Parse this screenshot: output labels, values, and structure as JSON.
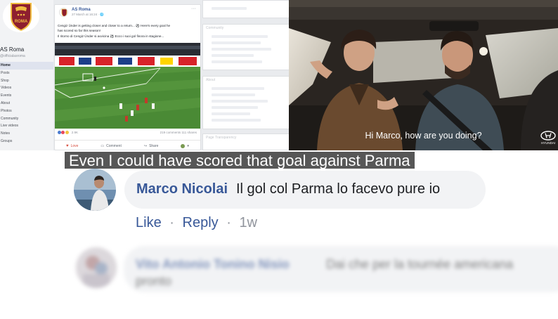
{
  "facebook_page": {
    "page_name": "AS Roma",
    "handle": "@officialasroma",
    "logo_text": "ROMA",
    "nav": [
      {
        "label": "Home",
        "active": true
      },
      {
        "label": "Posts",
        "active": false
      },
      {
        "label": "Shop",
        "active": false
      },
      {
        "label": "Videos",
        "active": false
      },
      {
        "label": "Events",
        "active": false
      },
      {
        "label": "About",
        "active": false
      },
      {
        "label": "Photos",
        "active": false
      },
      {
        "label": "Community",
        "active": false
      },
      {
        "label": "Live videos",
        "active": false
      },
      {
        "label": "Notes",
        "active": false
      },
      {
        "label": "Groups",
        "active": false
      }
    ],
    "post": {
      "author": "AS Roma",
      "date": "27 March at 16:24 · 🌐",
      "text_line1": "Cengiz Ünder is getting closer and closer to a return... ⚽ Here's every goal he",
      "text_line2": "has scored so far this season!",
      "text_line3": "Il ritorno di Cengiz Ünder si avvicina ⚽ Ecco i suoi gol finora in stagione...",
      "reaction_count": "2.9K",
      "comments_shares": "219 comments 111 shares",
      "actions": {
        "like": "Love",
        "comment": "Comment",
        "share": "Share"
      }
    },
    "sidebar_boxes": {
      "community_title": "Community",
      "about_title": "About",
      "transparency_title": "Page Transparency"
    }
  },
  "video": {
    "subtitle": "Hi Marco, how are you doing?",
    "brand": "HYUNDAI"
  },
  "comment": {
    "author": "Marco Nicolai",
    "text": "Il gol col Parma lo facevo pure io",
    "like_label": "Like",
    "separator": "·",
    "reply_label": "Reply",
    "time": "1w"
  },
  "blurred_comment": {
    "author": "Vito Antonio Tonino Nisio",
    "text": "Dai che per la tournée americana",
    "text2": "pronto"
  },
  "caption": "Even I could have scored that goal against Parma",
  "colors": {
    "fb_blue": "#385898",
    "bubble_gray": "#f2f3f5",
    "roma_red": "#8e1f2f",
    "roma_gold": "#f0bc42"
  }
}
